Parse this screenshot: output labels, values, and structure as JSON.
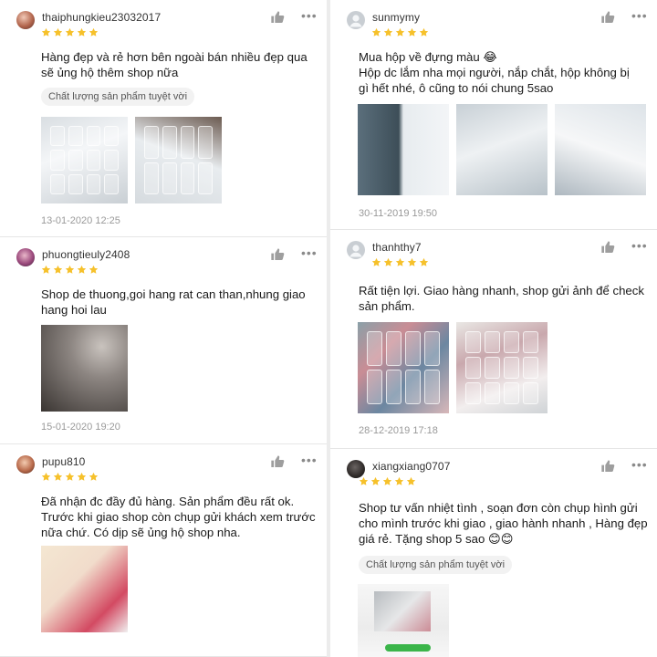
{
  "colors": {
    "star": "#f6c12b",
    "like_icon": "#9e9e9e",
    "tag_bg": "#f2f2f2",
    "date": "#999999"
  },
  "icons": {
    "like": "thumbs-up-icon",
    "more": "more-dots-icon",
    "star": "star-icon",
    "laughing_emoji": "😂",
    "smile_emoji": "😊"
  },
  "left": [
    {
      "username": "thaiphungkieu23032017",
      "rating": 5,
      "text": "Hàng đẹp và rẻ hơn bên ngoài bán nhiều đẹp qua sẽ ủng hộ thêm shop nữa",
      "tag": "Chất lượng sản phẩm tuyệt vời",
      "date": "13-01-2020 12:25"
    },
    {
      "username": "phuongtieuly2408",
      "rating": 5,
      "text": "Shop de thuong,goi hang rat can than,nhung giao hang hoi lau",
      "date": "15-01-2020 19:20"
    },
    {
      "username": "pupu810",
      "rating": 5,
      "text": "Đã nhận đc đầy đủ hàng. Sản phẩm đều rất ok. Trước khi giao shop còn chụp gửi khách xem trước nữa chứ. Có dịp sẽ ủng hộ shop nha."
    }
  ],
  "right": [
    {
      "username": "sunmymy",
      "rating": 5,
      "text": "Mua hộp về đựng màu 😂\nHộp dc lắm nha mọi người, nắp chắt, hộp không bị gì hết nhé, ô cũng to nói chung 5sao",
      "date": "30-11-2019 19:50"
    },
    {
      "username": "thanhthy7",
      "rating": 5,
      "text": "Rất tiện lợi. Giao hàng nhanh, shop gửi ảnh để check sản phẩm.",
      "date": "28-12-2019 17:18"
    },
    {
      "username": "xiangxiang0707",
      "rating": 5,
      "text": "Shop tư vấn nhiệt tình , soạn đơn còn chụp hình gửi cho mình trước khi giao , giao hành nhanh , Hàng đẹp giá rẻ. Tặng shop 5 sao 😊😊",
      "tag": "Chất lượng sản phẩm tuyệt vời"
    }
  ]
}
